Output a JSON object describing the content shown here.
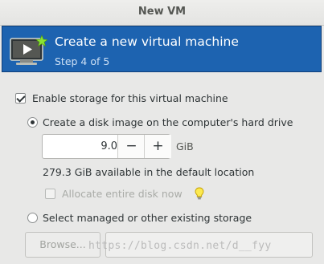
{
  "window": {
    "title": "New VM"
  },
  "banner": {
    "title": "Create a new virtual machine",
    "step": "Step 4 of 5",
    "icon": "new-vm-monitor-icon",
    "background": "#1d63b0"
  },
  "storage": {
    "enable_label": "Enable storage for this virtual machine",
    "enable_checked": true,
    "create_disk_label": "Create a disk image on the computer's hard drive",
    "create_disk_selected": true,
    "size_value": "9.0",
    "decrement_label": "−",
    "increment_label": "+",
    "size_unit": "GiB",
    "available_text": "279.3 GiB available in the default location",
    "allocate_label": "Allocate entire disk now",
    "allocate_checked": false,
    "select_existing_label": "Select managed or other existing storage",
    "select_existing_selected": false,
    "browse_label": "Browse..."
  },
  "watermark": "https://blog.csdn.net/d__fyy"
}
